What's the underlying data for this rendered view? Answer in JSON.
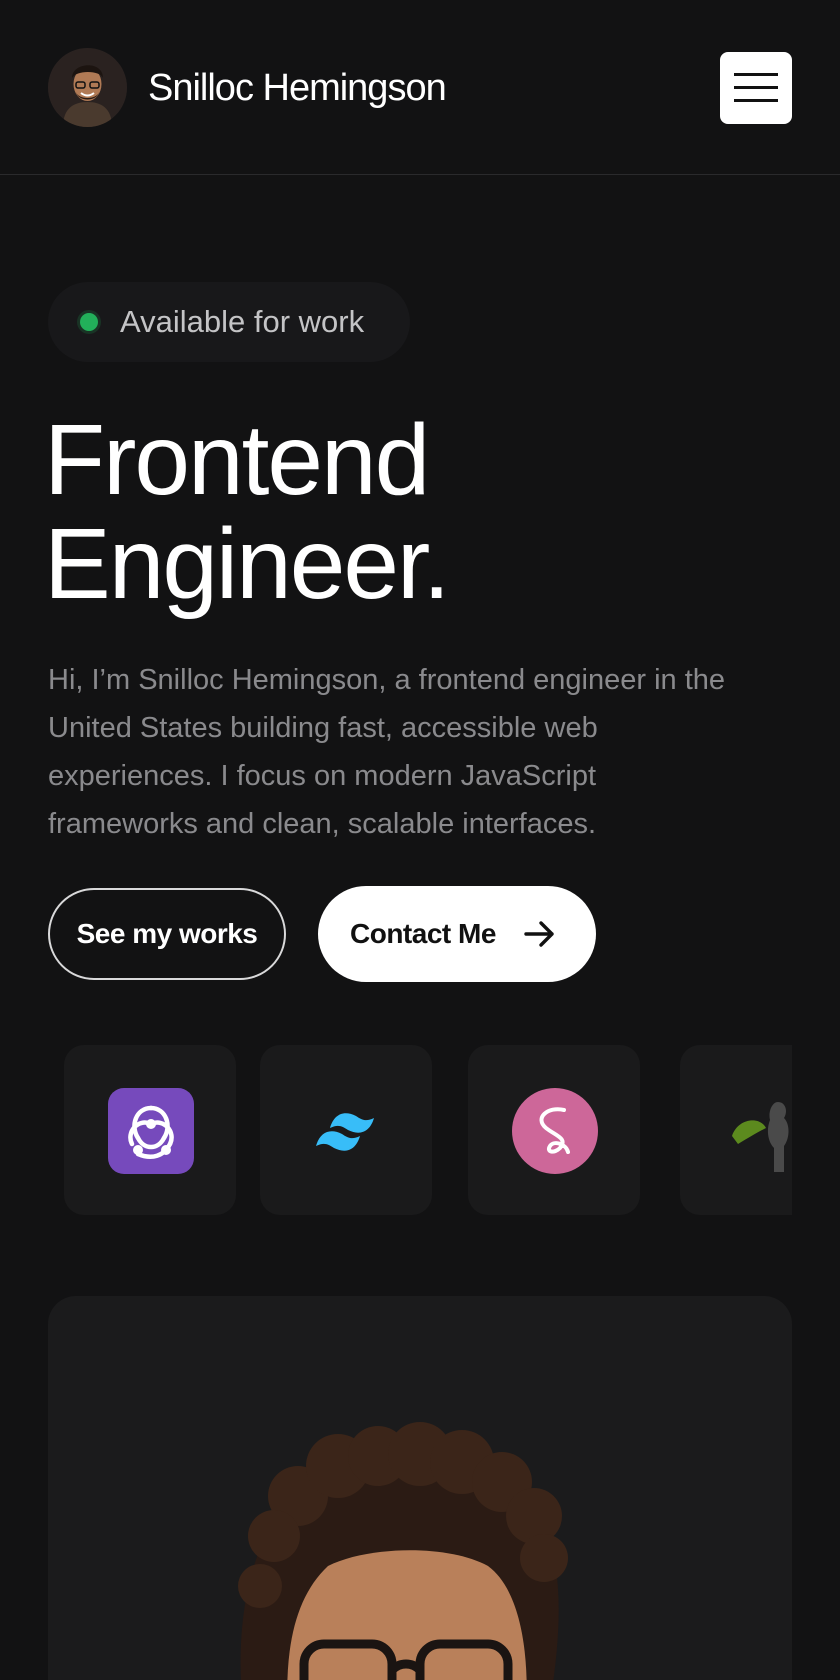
{
  "header": {
    "name": "Snilloc Hemingson",
    "menu_icon": "hamburger-menu-icon"
  },
  "hero": {
    "status": "Available for work",
    "status_color": "#22b05a",
    "headline_line1": "Frontend",
    "headline_line2": "Engineer.",
    "intro": "Hi, I’m Snilloc Hemingson, a frontend engineer in the United States building fast, accessible web experiences. I focus on modern JavaScript frameworks and clean, scalable interfaces."
  },
  "actions": {
    "works_label": "See my works",
    "contact_label": "Contact Me",
    "contact_icon": "arrow-right-icon"
  },
  "tech_stack": [
    {
      "icon": "redux-logo-icon"
    },
    {
      "icon": "tailwind-logo-icon"
    },
    {
      "icon": "sass-logo-icon"
    },
    {
      "icon": "nodejs-figure-icon"
    }
  ],
  "colors": {
    "background": "#121213",
    "card": "#1a1a1b",
    "accent_white": "#ffffff"
  }
}
